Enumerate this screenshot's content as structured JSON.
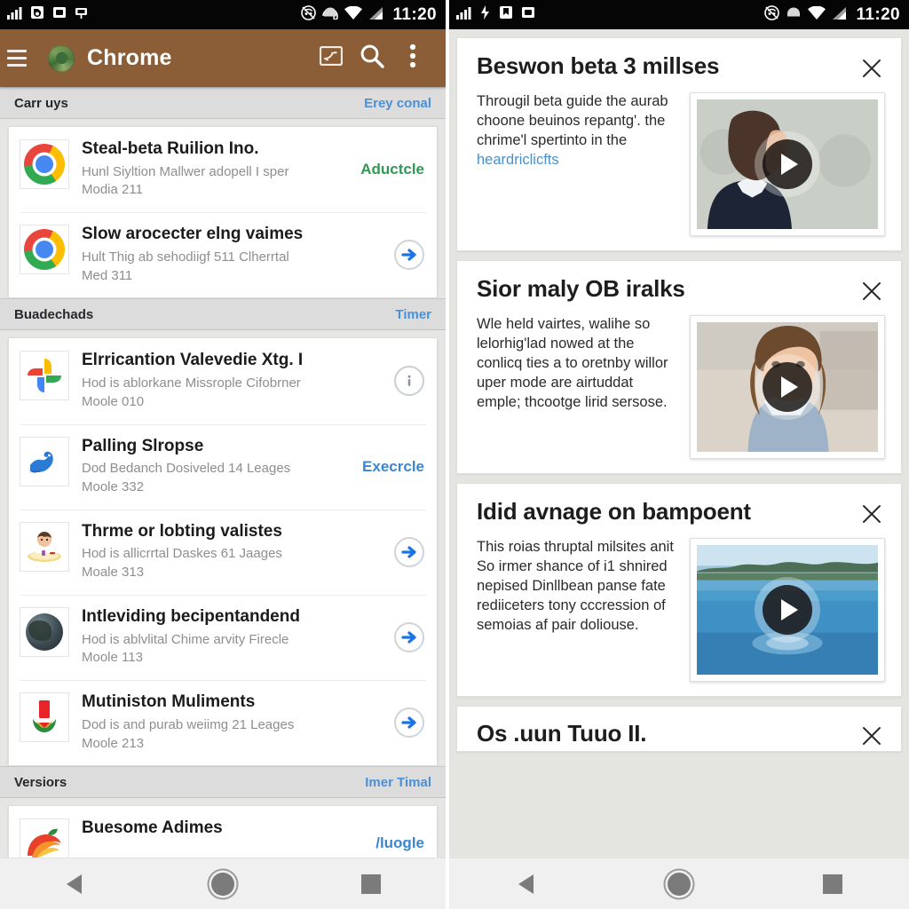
{
  "status_bar": {
    "time": "11:20",
    "left_icons": [
      "signal-bars-icon",
      "sd-card-icon",
      "screenshot-icon",
      "cast-icon"
    ],
    "left_icons_right": [
      "signal-bars-icon",
      "usb-debug-icon",
      "bookmark-icon",
      "screenshot-icon"
    ],
    "right_icons": [
      "no-sound-icon",
      "headset-icon",
      "wifi-icon",
      "cell-signal-icon"
    ],
    "background": "#050505"
  },
  "toolbar": {
    "title": "Chrome",
    "accent": "#8b5e38",
    "menu_icon": "hamburger-icon",
    "app_icon": "chrome-globe-icon",
    "cast_label": "cast-icon",
    "search_label": "search-icon",
    "overflow_label": "overflow-menu-icon"
  },
  "list": {
    "sections": [
      {
        "title": "Carr uys",
        "action": "Erey conal",
        "items": [
          {
            "icon": "chrome-icon",
            "title": "Steal-beta Ruilion Ino.",
            "sub1": "Hunl Siyltion Mallwer adopell I sper",
            "sub2": "Modia 211",
            "trail_type": "text",
            "trail_text": "Aductcle",
            "trail_color": "green"
          },
          {
            "icon": "chrome-icon",
            "title": "Slow arocecter elng vaimes",
            "sub1": "Hult Thig ab sehodiigf 511 Clherrtal",
            "sub2": "Med 311",
            "trail_type": "arrow",
            "trail_text": "",
            "trail_color": ""
          }
        ]
      },
      {
        "title": "Buadechads",
        "action": "Timer",
        "items": [
          {
            "icon": "google-photos-icon",
            "title": "Elrricantion Valevedie Xtg.  I",
            "sub1": "Hod is ablorkane Missrople Cifobrner",
            "sub2": "Moole 010",
            "trail_type": "info",
            "trail_text": "",
            "trail_color": ""
          },
          {
            "icon": "bird-icon",
            "title": "Palling Slropse",
            "sub1": "Dod Bedanch Dosiveled 14 Leages",
            "sub2": "Moole 332",
            "trail_type": "text",
            "trail_text": "Execrcle",
            "trail_color": "blue"
          },
          {
            "icon": "baby-icon",
            "title": "Thrme or lobting valistes",
            "sub1": "Hod is allicrrtal Daskes 61 Jaages",
            "sub2": "Moale 313",
            "trail_type": "arrow",
            "trail_text": "",
            "trail_color": ""
          },
          {
            "icon": "globe-icon",
            "title": "Intleviding becipentandend",
            "sub1": "Hod is ablvlital Chime arvity Firecle",
            "sub2": "Moole 113",
            "trail_type": "arrow",
            "trail_text": "",
            "trail_color": ""
          },
          {
            "icon": "flag-emblem-icon",
            "title": "Mutiniston Muliments",
            "sub1": "Dod is and purab weiimg 21 Leages",
            "sub2": "Moole 213",
            "trail_type": "arrow",
            "trail_text": "",
            "trail_color": ""
          }
        ]
      },
      {
        "title": "Versiors",
        "action": "Imer Timal",
        "items": [
          {
            "icon": "peach-icon",
            "title": "Buesome Adimes",
            "sub1": "",
            "sub2": "",
            "trail_type": "text",
            "trail_text": "/luogle",
            "trail_color": "blue"
          }
        ]
      }
    ]
  },
  "cards": [
    {
      "title": "Beswon beta 3 millses",
      "body": "Througil beta guide the aurab choone beuinos repantg'. the chrime'l spertinto in the",
      "link": "heardriclicfts",
      "thumb": "man-from-behind-photo",
      "play_label": "play-button",
      "close_label": "close-icon"
    },
    {
      "title": "Sior maly OB iralks",
      "body": "Wle held vairtes, walihe so lelorhig'lad nowed at the conlicq ties a to oretnby willor uper mode are airtuddat emple; thcootge lirid sersose.",
      "link": "",
      "thumb": "woman-portrait-photo",
      "play_label": "play-button",
      "close_label": "close-icon"
    },
    {
      "title": "Idid avnage on bampoent",
      "body": "This roias thruptal milsites anit So irmer shance of i1 shnired nepised Dinllbean panse fate rediiceters tony cccression of semoias af pair doliouse.",
      "link": "",
      "thumb": "lake-landscape-photo",
      "play_label": "play-button",
      "close_label": "close-icon"
    },
    {
      "title": "Os .uun Tuuo II.",
      "body": "",
      "link": "",
      "thumb": "",
      "play_label": "",
      "close_label": "close-icon"
    }
  ],
  "navbar": {
    "back": "back-triangle-icon",
    "home": "home-circle-icon",
    "recents": "recents-square-icon",
    "background": "#f0f0f0"
  }
}
